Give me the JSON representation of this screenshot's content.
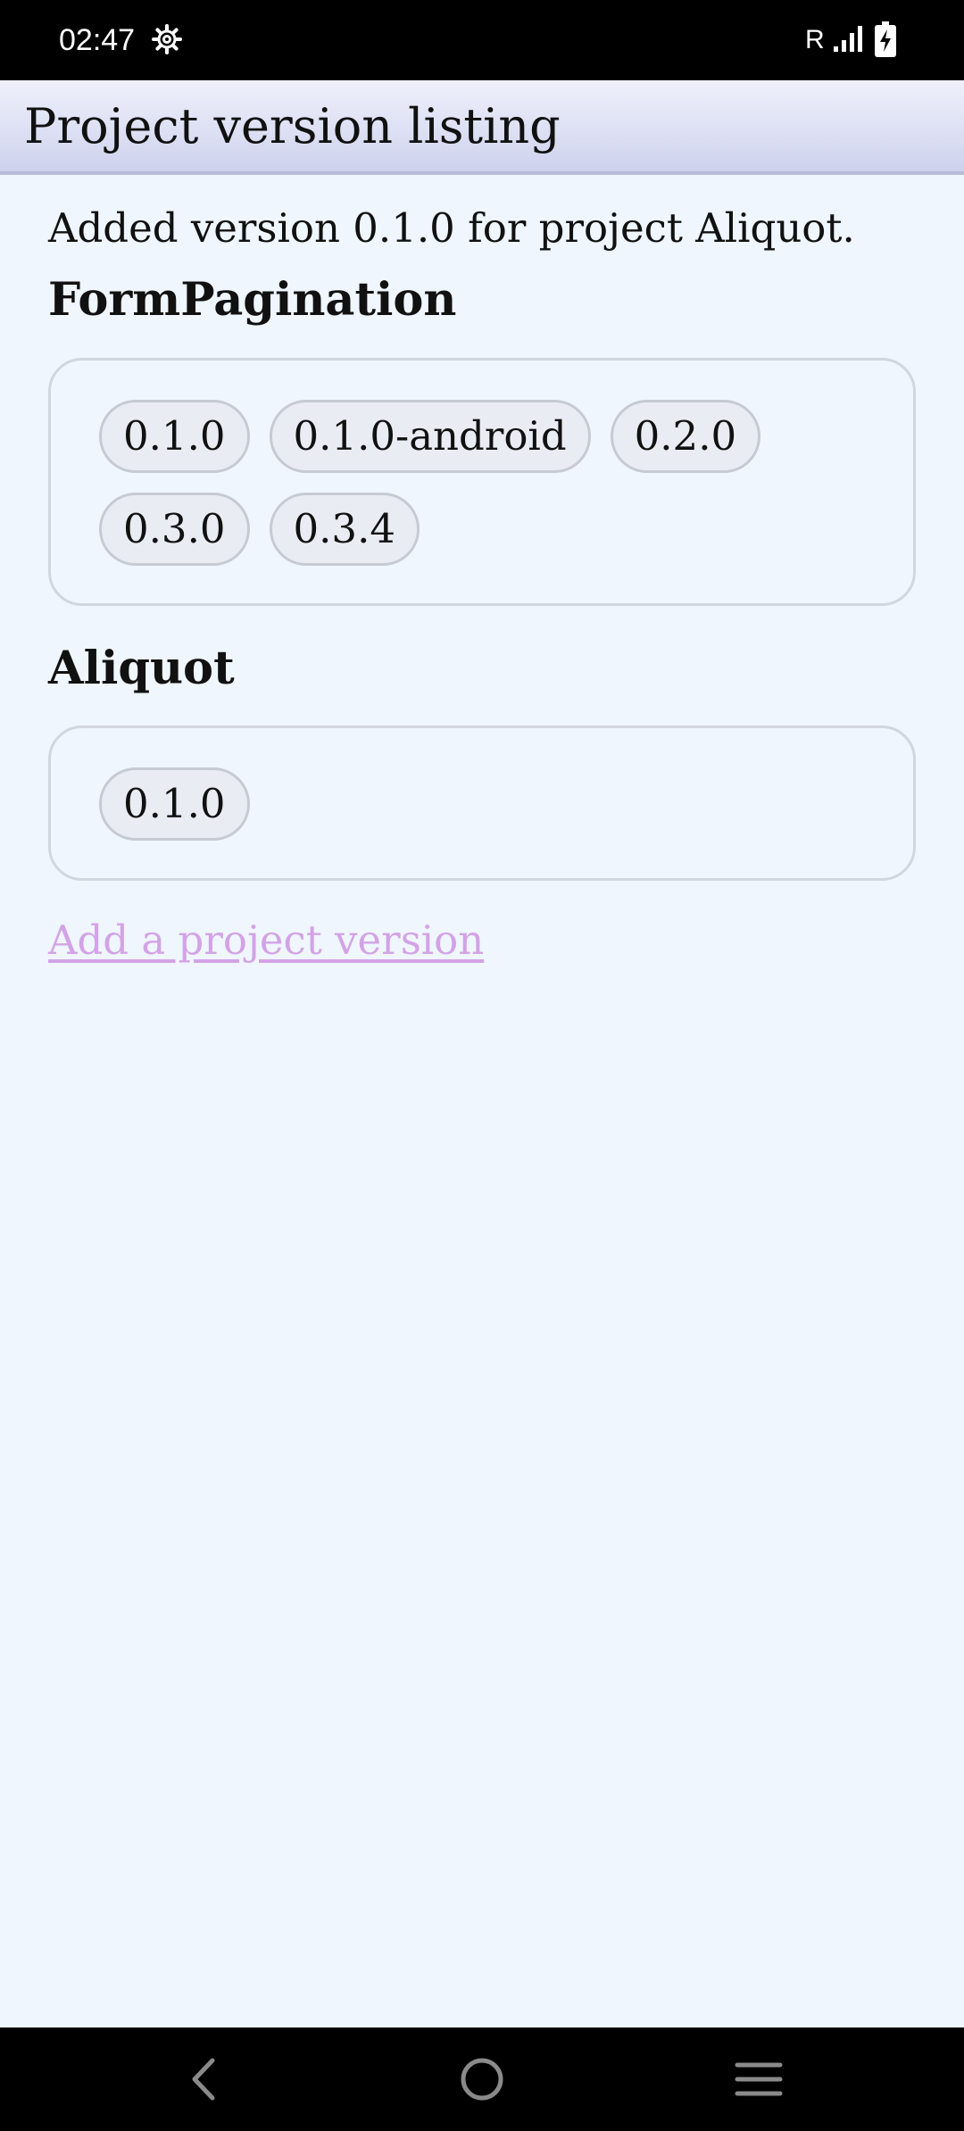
{
  "status_bar": {
    "time": "02:47",
    "roaming": "R",
    "icons": [
      "settings-gear-icon",
      "signal-icon",
      "battery-charging-icon"
    ]
  },
  "app_bar": {
    "title": "Project version listing"
  },
  "flash_message": "Added version 0.1.0 for project Aliquot.",
  "projects": [
    {
      "name": "FormPagination",
      "versions": [
        "0.1.0",
        "0.1.0-android",
        "0.2.0",
        "0.3.0",
        "0.3.4"
      ]
    },
    {
      "name": "Aliquot",
      "versions": [
        "0.1.0"
      ]
    }
  ],
  "add_link_label": "Add a project version",
  "nav_bar": {
    "buttons": [
      "back-icon",
      "home-icon",
      "recents-menu-icon"
    ]
  },
  "colors": {
    "background": "#eff6fe",
    "link_visited": "#d3a3e6",
    "chip_background": "#e9edf3",
    "chip_border": "#c6cad2"
  }
}
